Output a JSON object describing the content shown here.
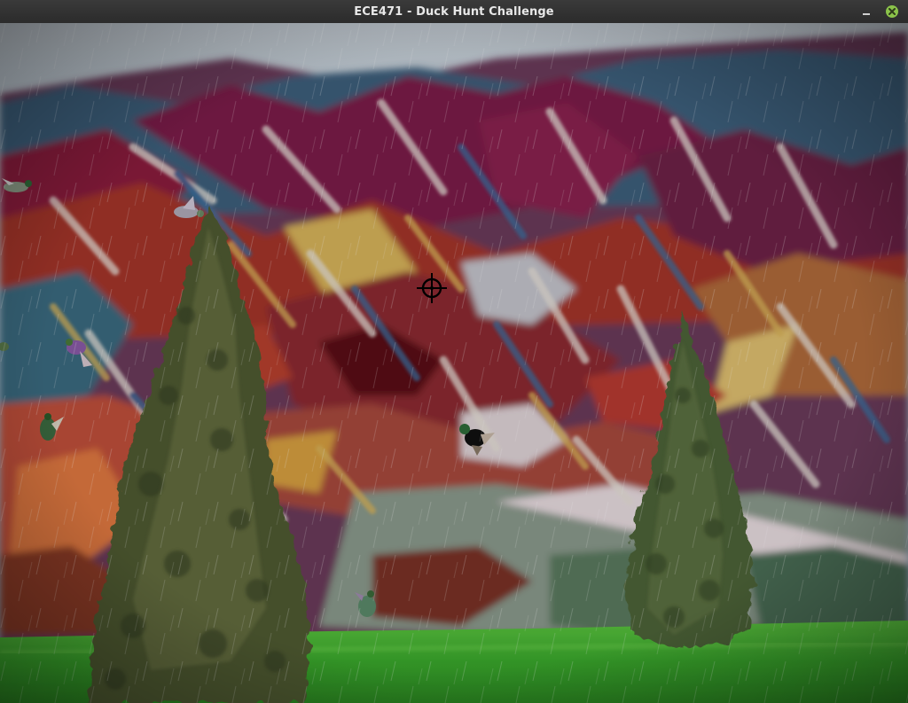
{
  "window": {
    "title": "ECE471 - Duck Hunt Challenge",
    "minimize_icon": "minimize-icon",
    "close_icon": "close-icon"
  },
  "game": {
    "crosshair_icon": "crosshair-icon",
    "duck_count": 7,
    "colors": {
      "sky": "#9bb0c4",
      "grass": "#3aa82c",
      "tree": "#4f5a30",
      "close_button": "#8bc34a"
    }
  }
}
